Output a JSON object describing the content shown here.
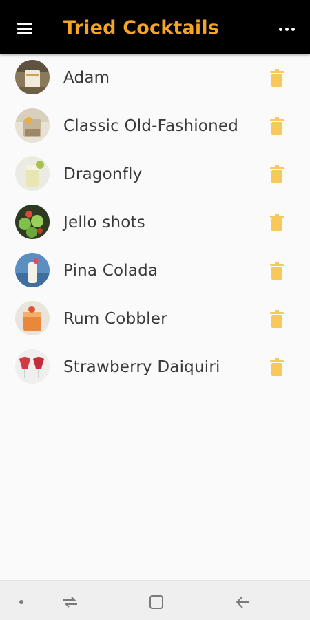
{
  "header": {
    "title": "Tried Cocktails",
    "menu_icon": "hamburger-menu-icon",
    "more_icon": "more-options-icon"
  },
  "cocktails": [
    {
      "name": "Adam"
    },
    {
      "name": "Classic Old-Fashioned"
    },
    {
      "name": "Dragonfly"
    },
    {
      "name": "Jello shots"
    },
    {
      "name": "Pina Colada"
    },
    {
      "name": "Rum Cobbler"
    },
    {
      "name": "Strawberry Daiquiri"
    }
  ],
  "colors": {
    "accent": "#f5a524",
    "appbar": "#000000",
    "background": "#fafafa",
    "delete_icon": "#f9c85a"
  },
  "navbar": {
    "icons": [
      "dot-indicator-icon",
      "recent-apps-icon",
      "home-icon",
      "back-icon"
    ]
  }
}
